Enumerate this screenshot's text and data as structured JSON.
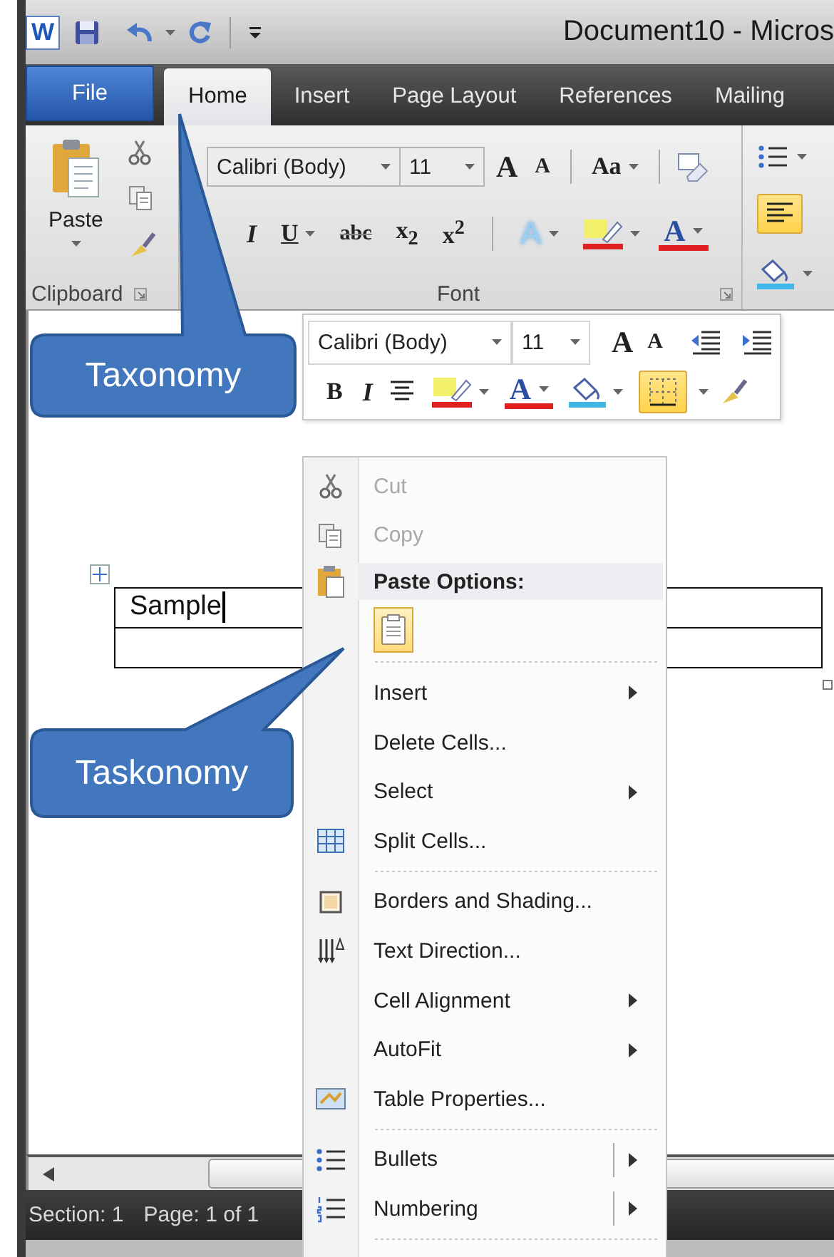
{
  "title_bar": {
    "app_icon": "W",
    "title": "Document10 - Micros"
  },
  "tabs": [
    {
      "label": "File",
      "selected": false
    },
    {
      "label": "Home",
      "selected": true
    },
    {
      "label": "Insert",
      "selected": false
    },
    {
      "label": "Page Layout",
      "selected": false
    },
    {
      "label": "References",
      "selected": false
    },
    {
      "label": "Mailing",
      "selected": false
    }
  ],
  "ribbon": {
    "clipboard": {
      "paste_label": "Paste",
      "group_label": "Clipboard"
    },
    "font": {
      "font_name": "Calibri (Body)",
      "font_size": "11",
      "glyphs_row1": [
        "A",
        "A",
        "Aa"
      ],
      "glyphs_row2": [
        "I",
        "U",
        "abc",
        "x$_{2}$",
        "x$^{2}$",
        "A",
        "A"
      ],
      "group_label": "Font"
    }
  },
  "mini_toolbar": {
    "font_name": "Calibri (Body)",
    "font_size": "11",
    "glyphs_row1": [
      "A",
      "A"
    ],
    "glyphs_row2": [
      "B",
      "I",
      "A"
    ]
  },
  "document": {
    "table": {
      "first_cell": "Sample"
    }
  },
  "context_menu": {
    "items": [
      {
        "kind": "command",
        "label": "Cut",
        "disabled": true
      },
      {
        "kind": "command",
        "label": "Copy",
        "disabled": true
      },
      {
        "kind": "header",
        "label": "Paste Options:"
      },
      {
        "kind": "paste-option"
      },
      {
        "kind": "separator"
      },
      {
        "kind": "submenu",
        "label": "Insert"
      },
      {
        "kind": "command",
        "label": "Delete Cells...",
        "disabled": false
      },
      {
        "kind": "submenu",
        "label": "Select"
      },
      {
        "kind": "command",
        "label": "Split Cells...",
        "disabled": false
      },
      {
        "kind": "separator"
      },
      {
        "kind": "command",
        "label": "Borders and Shading...",
        "disabled": false
      },
      {
        "kind": "command",
        "label": "Text Direction...",
        "disabled": false
      },
      {
        "kind": "submenu",
        "label": "Cell Alignment"
      },
      {
        "kind": "submenu",
        "label": "AutoFit"
      },
      {
        "kind": "command",
        "label": "Table Properties...",
        "disabled": false
      },
      {
        "kind": "separator"
      },
      {
        "kind": "split-submenu",
        "label": "Bullets"
      },
      {
        "kind": "split-submenu",
        "label": "Numbering"
      },
      {
        "kind": "separator"
      }
    ]
  },
  "callouts": [
    {
      "label": "Taxonomy"
    },
    {
      "label": "Taskonomy"
    }
  ],
  "status_bar": {
    "items": [
      "Section: 1",
      "Page: 1 of 1"
    ]
  }
}
